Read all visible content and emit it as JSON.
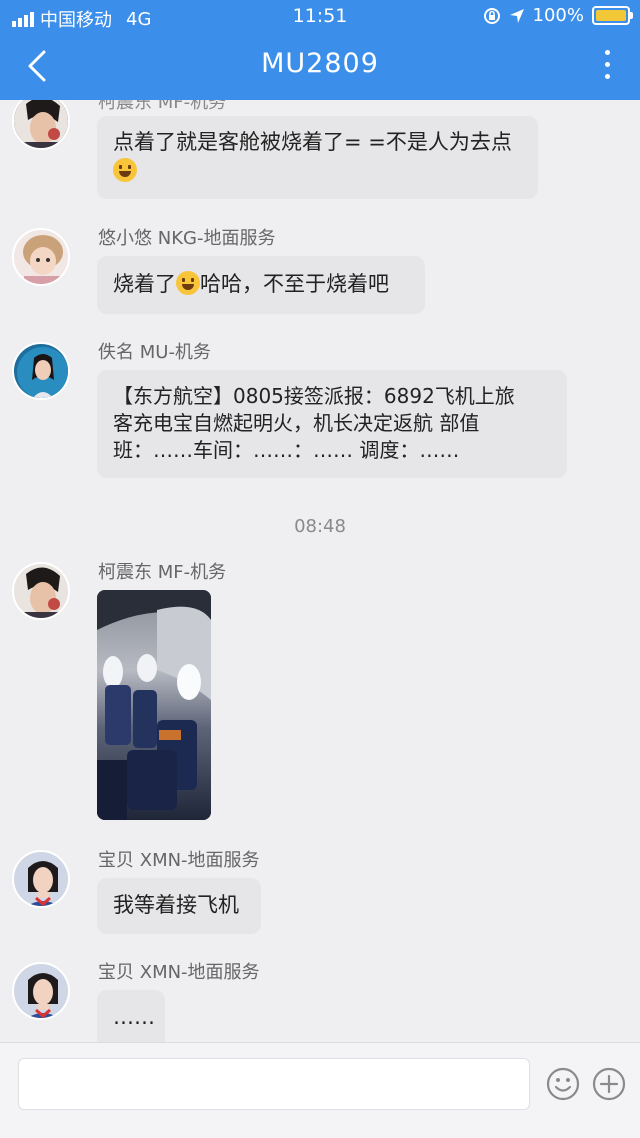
{
  "status_bar": {
    "carrier": "中国移动",
    "network": "4G",
    "time": "11:51",
    "battery": "100%",
    "battery_level": 1.0
  },
  "header": {
    "title": "MU2809"
  },
  "messages": [
    {
      "sender_name": "柯震东",
      "sender_tag": "MF-机务",
      "text": "点着了就是客舱被烧着了= =不是人为去点"
    },
    {
      "sender_name": "悠小悠",
      "sender_tag": "NKG-地面服务",
      "text_before_emoji": "烧着了",
      "text_after_emoji": "哈哈，不至于烧着吧"
    },
    {
      "sender_name": "佚名",
      "sender_tag": "MU-机务",
      "line1": "【东方航空】0805接签派报：6892飞机上旅",
      "line2": "客充电宝自燃起明火，机长决定返航  部值",
      "line3": "班：……车间：……：…… 调度：……"
    },
    {
      "time_separator": "08:48"
    },
    {
      "sender_name": "柯震东",
      "sender_tag": "MF-机务",
      "attachment": "photo"
    },
    {
      "sender_name": "宝贝",
      "sender_tag": "XMN-地面服务",
      "text": "我等着接飞机"
    },
    {
      "sender_name": "宝贝",
      "sender_tag": "XMN-地面服务",
      "text": "……"
    }
  ],
  "input": {
    "placeholder": "",
    "value": ""
  },
  "icons": {
    "back": "back-chevron-icon",
    "more": "more-vertical-icon",
    "emoji": "emoji-icon",
    "add": "add-circle-icon"
  },
  "colors": {
    "header_bg": "#3b8fea",
    "bubble_bg": "#e6e6e8",
    "chat_bg": "#efeff2"
  }
}
